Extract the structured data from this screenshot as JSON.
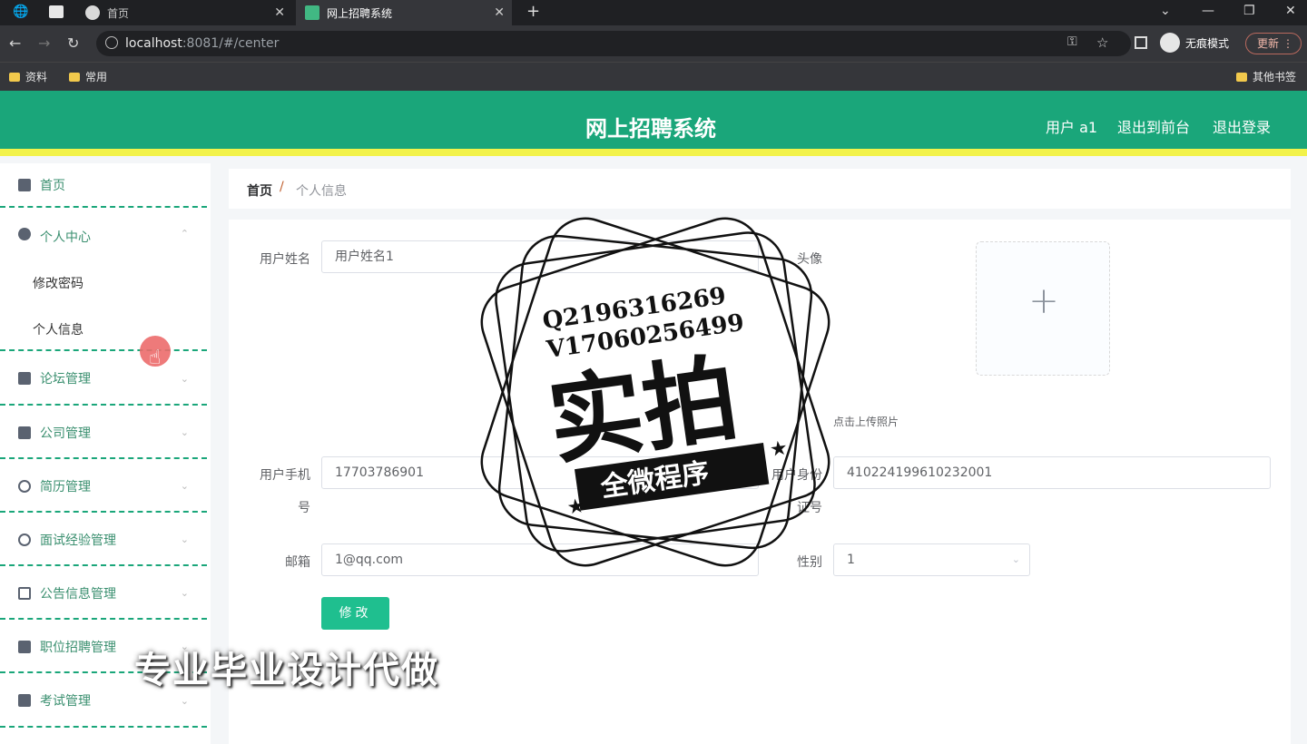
{
  "browser": {
    "tabs": [
      {
        "label": "首页"
      },
      {
        "label": "网上招聘系统"
      }
    ],
    "new_tab": "+",
    "window_controls": [
      "⌄",
      "—",
      "❐",
      "✕"
    ],
    "url_host": "localhost",
    "url_rest": ":8081/#/center",
    "incognito_label": "无痕模式",
    "update_label": "更新",
    "bookmarks": [
      {
        "label": "资料"
      },
      {
        "label": "常用"
      }
    ],
    "other_bookmarks": "其他书签"
  },
  "header": {
    "title": "网上招聘系统",
    "user": "用户 a1",
    "back_to_front": "退出到前台",
    "logout": "退出登录",
    "colors": {
      "bar": "#1aa67a",
      "accent_line": "#f2f24a"
    }
  },
  "sidebar": {
    "items": [
      {
        "label": "首页",
        "icon": "home-icon"
      },
      {
        "label": "个人中心",
        "icon": "user-icon"
      },
      {
        "label": "论坛管理",
        "icon": "briefcase-icon"
      },
      {
        "label": "公司管理",
        "icon": "list-icon"
      },
      {
        "label": "简历管理",
        "icon": "power-icon"
      },
      {
        "label": "面试经验管理",
        "icon": "gauge-icon"
      },
      {
        "label": "公告信息管理",
        "icon": "mail-icon"
      },
      {
        "label": "职位招聘管理",
        "icon": "printer-icon"
      },
      {
        "label": "考试管理",
        "icon": "clipboard-icon"
      }
    ],
    "sub_items": [
      {
        "label": "修改密码"
      },
      {
        "label": "个人信息"
      }
    ]
  },
  "breadcrumb": {
    "home": "首页",
    "separator": "/",
    "current": "个人信息"
  },
  "form": {
    "username": {
      "label": "用户姓名",
      "value": "用户姓名1"
    },
    "avatar": {
      "label": "头像",
      "tip": "点击上传照片"
    },
    "phone": {
      "label_line1": "用户手机",
      "label_line2": "号",
      "value": "17703786901"
    },
    "idcard": {
      "label_line1": "用户身份",
      "label_line2": "证号",
      "value": "410224199610232001"
    },
    "email": {
      "label": "邮箱",
      "value": "1@qq.com"
    },
    "gender": {
      "label": "性别",
      "value": "1"
    },
    "submit": "修改"
  },
  "watermark": {
    "qq": "Q2196316269",
    "v": "V17060256499",
    "big": "实拍",
    "ribbon": "全微程序",
    "caption": "专业毕业设计代做"
  }
}
